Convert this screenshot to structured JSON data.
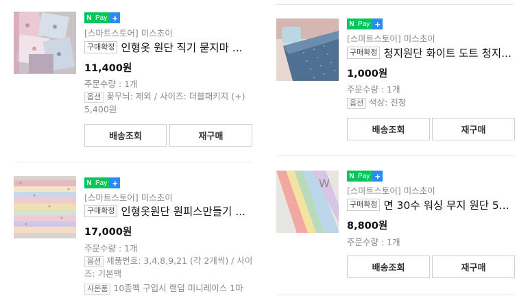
{
  "items": [
    {
      "store": "[스마트스토어] 미스초이",
      "status_badge": "구매확정",
      "title": "인형옷 원단 직기 묻지마 ...",
      "price": "11,400원",
      "quantity": "주문수량 : 1개",
      "option_tag": "옵션",
      "option_text_1": "꽃무늬: 제외 / 사이즈: 더블패키지 (+)",
      "option_text_2": "5,400원",
      "buttons": [
        "배송조회",
        "재구매"
      ]
    },
    {
      "store": "[스마트스토어] 미스초이",
      "status_badge": "구매확정",
      "title": "인형옷원단 원피스만들기 ...",
      "price": "17,000원",
      "quantity": "주문수량 : 1개",
      "option_tag": "옵션",
      "option_text_1": "제품번호: 3,4,8,9,21 (각 2개씩) / 사이",
      "option_text_2": "즈: 기본팩",
      "gift_tag": "사은품",
      "gift_text": "10종팩 구입시 랜덤 미니레이스 1마"
    },
    {
      "store": "[스마트스토어] 미스초이",
      "status_badge": "구매확정",
      "title": "청지원단 화이트 도트 청지...",
      "price": "1,000원",
      "quantity": "주문수량 : 1개",
      "option_tag": "옵션",
      "option_text_1": "색상: 진청",
      "buttons": [
        "배송조회",
        "재구매"
      ]
    },
    {
      "store": "[스마트스토어] 미스초이",
      "status_badge": "구매확정",
      "title": "면 30수 워싱 무지 원단 5...",
      "price": "8,800원",
      "quantity": "주문수량 : 1개",
      "buttons": [
        "배송조회",
        "재구매"
      ]
    }
  ],
  "npay": {
    "n": "N",
    "pay": "Pay",
    "plus": "+"
  },
  "icons": {
    "npay_logo": "npay-logo-icon"
  },
  "colors": {
    "npay_green": "#03c75a",
    "npay_blue": "#2a8cf2"
  }
}
